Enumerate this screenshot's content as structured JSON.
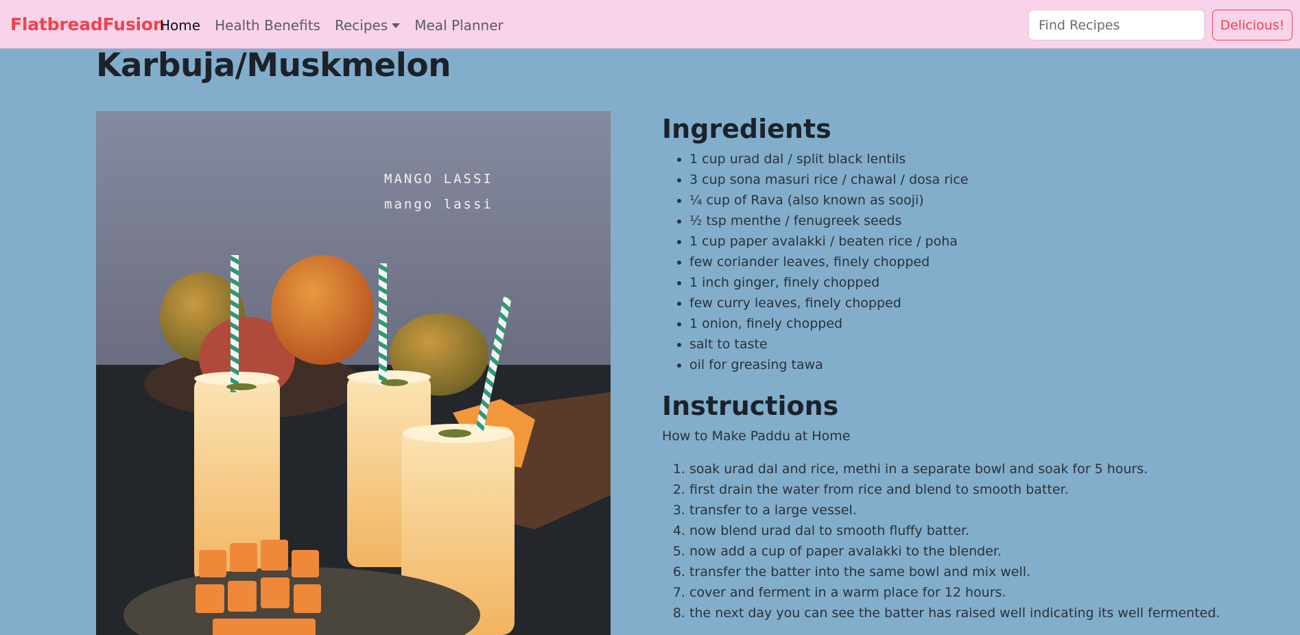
{
  "navbar": {
    "brand": "FlatbreadFusion",
    "links": [
      {
        "label": "Home",
        "active": true
      },
      {
        "label": "Health Benefits",
        "active": false
      },
      {
        "label": "Recipes",
        "active": false,
        "dropdown": true
      },
      {
        "label": "Meal Planner",
        "active": false
      }
    ],
    "search_placeholder": "Find Recipes",
    "search_button": "Delicious!"
  },
  "page": {
    "title": "Karbuja/Muskmelon",
    "image_text": [
      "MANGO LASSI",
      "mango lassi"
    ]
  },
  "ingredients": {
    "heading": "Ingredients",
    "items": [
      "1 cup urad dal / split black lentils",
      "3 cup sona masuri rice / chawal / dosa rice",
      "¼ cup of Rava (also known as sooji)",
      "½ tsp menthe / fenugreek seeds",
      "1 cup paper avalakki / beaten rice / poha",
      "few coriander leaves, finely chopped",
      "1 inch ginger, finely chopped",
      "few curry leaves, finely chopped",
      "1 onion, finely chopped",
      "salt to taste",
      "oil for greasing tawa"
    ]
  },
  "instructions": {
    "heading": "Instructions",
    "intro": "How to Make Paddu at Home",
    "steps": [
      "soak urad dal and rice, methi in a separate bowl and soak for 5 hours.",
      "first drain the water from rice and blend to smooth batter.",
      "transfer to a large vessel.",
      "now blend urad dal to smooth fluffy batter.",
      "now add a cup of paper avalakki to the blender.",
      "transfer the batter into the same bowl and mix well.",
      "cover and ferment in a warm place for 12 hours.",
      "the next day you can see the batter has raised well indicating its well fermented."
    ]
  },
  "colors": {
    "navbar_bg": "#f9d3ea",
    "brand": "#f0424e",
    "page_bg": "#82aecb"
  }
}
